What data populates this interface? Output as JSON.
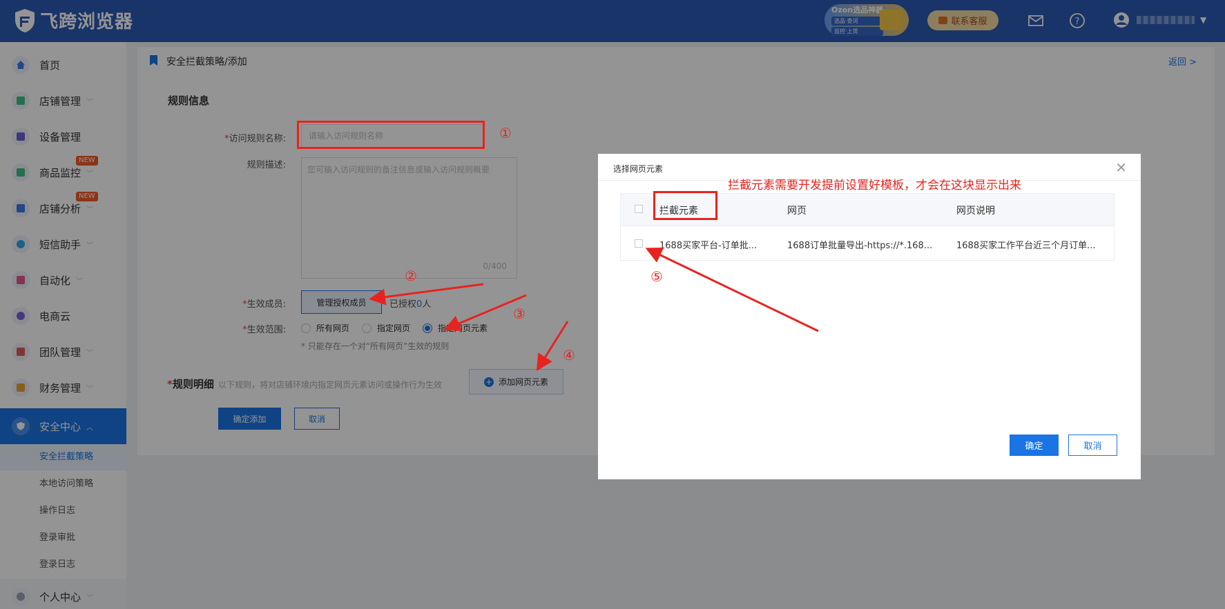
{
  "header": {
    "brand": "飞跨浏览器",
    "ozon_badge": {
      "line1": "Ozon选品神器",
      "line2": "选品·查词",
      "line3": "监控·上货"
    },
    "contact_label": "联系客服",
    "colors": {
      "header_bg": "#2b5bb5",
      "accent": "#1b74e4",
      "annotation_red": "#e8231f"
    }
  },
  "sidebar": {
    "items": [
      {
        "label": "首页",
        "icon": "home-icon"
      },
      {
        "label": "店铺管理",
        "icon": "store-icon"
      },
      {
        "label": "设备管理",
        "icon": "device-icon"
      },
      {
        "label": "商品监控",
        "icon": "monitor-icon",
        "badge": "NEW"
      },
      {
        "label": "店铺分析",
        "icon": "analysis-icon",
        "badge": "NEW"
      },
      {
        "label": "短信助手",
        "icon": "sms-icon"
      },
      {
        "label": "自动化",
        "icon": "robot-icon"
      },
      {
        "label": "电商云",
        "icon": "cloud-icon"
      },
      {
        "label": "团队管理",
        "icon": "team-icon"
      },
      {
        "label": "财务管理",
        "icon": "wallet-icon"
      },
      {
        "label": "安全中心",
        "icon": "shield-icon"
      },
      {
        "label": "个人中心",
        "icon": "user-icon"
      }
    ],
    "sub_items": [
      "安全拦截策略",
      "本地访问策略",
      "操作日志",
      "登录审批",
      "登录日志"
    ]
  },
  "main": {
    "breadcrumb": "安全拦截策略/添加",
    "back": "返回",
    "section_title": "规则信息",
    "name_label": "访问规则名称:",
    "name_placeholder": "请输入访问规则名称",
    "desc_label": "规则描述:",
    "desc_placeholder": "您可输入访问规则的备注信息或输入访问规则概要",
    "desc_count": "0/400",
    "members_label": "生效成员:",
    "manage_btn": "管理授权成员",
    "authed_prefix": "已授权",
    "authed_count": "0",
    "authed_suffix": "人",
    "scope_label": "生效范围:",
    "scope_options": [
      "所有网页",
      "指定网页",
      "指定网页元素"
    ],
    "scope_selected": "指定网页元素",
    "scope_tip": "* 只能存在一个对“所有网页”生效的规则",
    "detail_title": "规则明细",
    "detail_desc": "以下规则，将对店铺环境内指定网页元素访问或操作行为生效",
    "add_element_btn": "添加网页元素",
    "confirm_add": "确定添加",
    "cancel": "取消"
  },
  "modal": {
    "title": "选择网页元素",
    "columns": [
      "拦截元素",
      "网页",
      "网页说明"
    ],
    "rows": [
      {
        "element": "1688买家平台-订单批...",
        "page": "1688订单批量导出-https://*.168...",
        "desc": "1688买家工作平台近三个月订单..."
      }
    ],
    "ok": "确定",
    "cancel": "取消"
  },
  "annotations": {
    "nums": [
      "①",
      "②",
      "③",
      "④",
      "⑤"
    ],
    "note": "拦截元素需要开发提前设置好模板，才会在这块显示出来"
  }
}
